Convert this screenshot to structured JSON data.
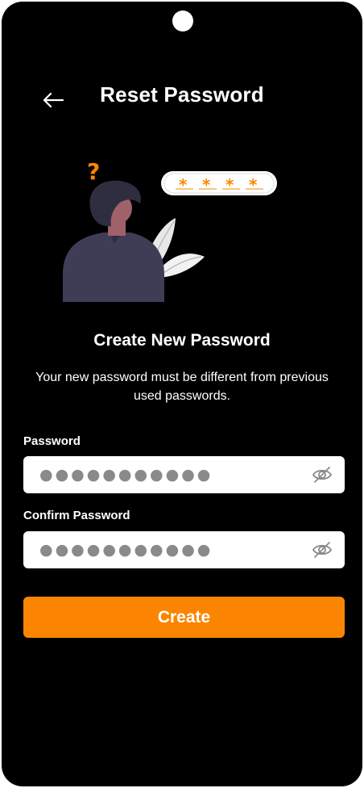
{
  "header": {
    "title": "Reset Password",
    "back_icon": "arrow-left-icon"
  },
  "illustration": {
    "question_mark": "?",
    "password_chars": [
      "*",
      "*",
      "*",
      "*"
    ]
  },
  "main": {
    "subtitle": "Create New Password",
    "description": "Your new password must be different from previous used passwords."
  },
  "form": {
    "password": {
      "label": "Password",
      "value": "●●●●●●●●●●●",
      "toggle_icon": "eye-slash-icon"
    },
    "confirm_password": {
      "label": "Confirm Password",
      "value": "●●●●●●●●●●●",
      "toggle_icon": "eye-slash-icon"
    },
    "submit_label": "Create"
  },
  "colors": {
    "background": "#000000",
    "accent": "#FB8500",
    "field_background": "#ffffff",
    "text_primary": "#ffffff",
    "placeholder": "#8a8a8a"
  }
}
